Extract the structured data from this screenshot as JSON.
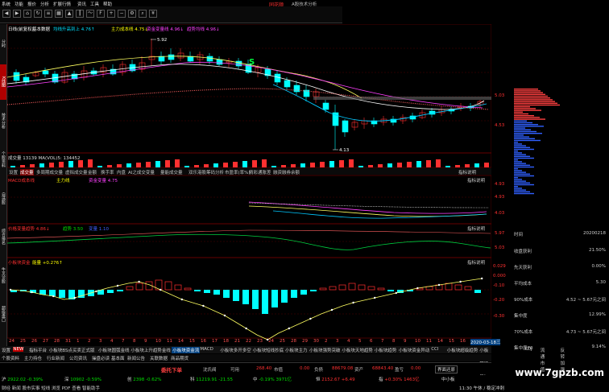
{
  "menubar": {
    "items": [
      "系统",
      "功能",
      "报价",
      "分析",
      "扩展行情",
      "资讯",
      "工具",
      "帮助"
    ],
    "logo": "同花顺",
    "title": "A股技术分析"
  },
  "sidebar": {
    "tabs": [
      "分时",
      "K线图",
      "技术分析",
      "个股资料",
      "自选股",
      "综合排名",
      "牛叉诊股",
      "超级盘口"
    ],
    "active": 1
  },
  "main_chart": {
    "header_items": [
      {
        "text": "日线(前复权)",
        "color": "#ffffff"
      },
      {
        "text": "基本数据",
        "color": "#ffffff"
      },
      {
        "text": "均线升高到上 4.76↑",
        "color": "#00e0ff"
      },
      {
        "text": "主力成本线 4.75↓",
        "color": "#ffff00"
      },
      {
        "text": "资金变量线 4.96↓",
        "color": "#ff40ff"
      },
      {
        "text": "趋势均线 4.96↓",
        "color": "#ff40ff"
      }
    ],
    "high_label": "5.92",
    "low_label": "4.13",
    "s_marker": "S",
    "price_ticks": [
      "5.03",
      "4.53"
    ]
  },
  "volume_panel": {
    "header": "成交量 13139 MA(VOL)5: 134452"
  },
  "indicator_tabs": [
    "设置",
    "成交量",
    "多周期成交量",
    "虚拟成交量",
    "金额",
    "换手率",
    "内盘",
    "AI之成交变量",
    "量能成交量",
    "双乐港股筹码分析",
    "市盈率(率%)",
    "精彩通胀差",
    "融资融券余额"
  ],
  "panel2": {
    "header_items": [
      {
        "text": "MACD成本线",
        "color": "#ff3030"
      },
      {
        "text": "主力线",
        "color": "#ffff00"
      },
      {
        "text": "资金变量 4.75",
        "color": "#ff40ff"
      }
    ],
    "right_label": "指标说明",
    "ticks": [
      "4.93",
      "4.93",
      "4.03"
    ]
  },
  "panel3": {
    "header_items": [
      {
        "text": "价格变量趋势 4.86↓",
        "color": "#ff3030"
      },
      {
        "text": "趋势 3.50",
        "color": "#00e000"
      },
      {
        "text": "变量 1.10",
        "color": "#4060ff"
      }
    ],
    "right_label": "指标说明",
    "ticks": [
      "5.97",
      "5.03"
    ]
  },
  "panel4": {
    "header_items": [
      {
        "text": "小板块资金",
        "color": "#ff3030"
      },
      {
        "text": "能量 +0.276↑",
        "color": "#ffff00"
      }
    ],
    "right_label": "指标说明",
    "ticks": [
      "0.029",
      "0.000",
      "-0.10",
      "-0.20",
      "-0.30"
    ]
  },
  "timeline": {
    "labels": [
      "24",
      "25",
      "26",
      "27",
      "28",
      "31",
      "1",
      "2",
      "3",
      "4",
      "7",
      "8",
      "9",
      "10",
      "11",
      "14",
      "15",
      "16",
      "17",
      "18",
      "21",
      "22",
      "23",
      "24",
      "25",
      "28",
      "29",
      "30",
      "2",
      "3",
      "4",
      "5",
      "6",
      "7",
      "8",
      "9",
      "10",
      "11",
      "14",
      "15",
      "16",
      "17"
    ],
    "date_box": "2020-03-18三"
  },
  "bottom_tabs": [
    {
      "label": "设置",
      "active": false
    },
    {
      "label": "NEW",
      "active": false
    },
    {
      "label": "指标平台",
      "active": false
    },
    {
      "label": "小板块BS点买卖正式版",
      "active": false
    },
    {
      "label": "小板块圆弧金线",
      "active": false
    },
    {
      "label": "小板块上升趋势金线",
      "active": false
    },
    {
      "label": "小板块资金流",
      "active": true
    },
    {
      "label": "MACD",
      "active": false
    },
    {
      "label": "小板块多开多空",
      "active": false
    },
    {
      "label": "小板块短线抄底",
      "active": false
    },
    {
      "label": "小板块主力",
      "active": false
    },
    {
      "label": "小板块强势突破",
      "active": false
    },
    {
      "label": "小板块天地趋势",
      "active": false
    },
    {
      "label": "小板块趋势",
      "active": false
    },
    {
      "label": "小板块资金异动",
      "active": false
    },
    {
      "label": "CCI",
      "active": false
    },
    {
      "label": "小板块超级趋势",
      "active": false
    },
    {
      "label": "小板块操盘线（2号）",
      "active": false
    },
    {
      "label": "KDJ",
      "active": false
    },
    {
      "label": "流通市值",
      "active": false
    },
    {
      "label": "反转加强",
      "active": false
    }
  ],
  "sub_tabs": [
    "个股资料",
    "主力持仓",
    "行业新闻",
    "公司资讯",
    "操盘必读",
    "基本面",
    "新闻公告",
    "关联数据",
    "商品期货"
  ],
  "tradebar": {
    "buy_button": "委托下单",
    "fields": [
      {
        "label": "沈氏阀",
        "value": ""
      },
      {
        "label": "可用",
        "value": "268.40"
      },
      {
        "label": "市值",
        "value": "0.00"
      },
      {
        "label": "负债",
        "value": "88679.08"
      },
      {
        "label": "资产",
        "value": "68843.40"
      },
      {
        "label": "盈亏",
        "value": "0.00"
      }
    ],
    "restore_button": "界面还原"
  },
  "status_row": [
    {
      "name": "沪",
      "value": "2922.02",
      "chg": "-0.39%",
      "color": "down"
    },
    {
      "name": "深",
      "value": "10902",
      "chg": "-0.59%",
      "color": "down"
    },
    {
      "name": "创",
      "value": "2398",
      "chg": "-0.62%",
      "color": "down"
    },
    {
      "name": "科",
      "value": "11219.91",
      "chg": "-21.55",
      "color": "down"
    },
    {
      "name": "中",
      "value": "-0.19%",
      "chg": "3971亿",
      "color": "down"
    },
    {
      "name": "恒",
      "value": "2152.67",
      "chg": "+6.49",
      "color": "up"
    },
    {
      "name": "指",
      "value": "+0.30%",
      "chg": "1463亿",
      "color": "up"
    },
    {
      "name": "中小板",
      "value": "",
      "chg": "",
      "color": "up"
    }
  ],
  "status_bottom": {
    "left": "财经 新闻 股市实事 短线 浏览 PDF 查看 智能助手",
    "right": "11:30 午休 / 稳定冲刺"
  },
  "right_panel": {
    "rows": [
      {
        "label": "时间",
        "value": "20200218"
      },
      {
        "label": "收盘获利",
        "value": "21.50%"
      },
      {
        "label": "获利盘",
        "value": ""
      },
      {
        "label": "先天获利",
        "value": "0.00%"
      },
      {
        "label": "平均成本",
        "value": "5.30"
      },
      {
        "label": "90%成本",
        "value": "4.52 ~ 5.67元之间"
      },
      {
        "label": "集中度",
        "value": "12.99%"
      },
      {
        "label": "70%成本",
        "value": "4.73 ~ 5.67元之间"
      },
      {
        "label": "集中度70",
        "value": "9.14%"
      }
    ]
  },
  "watermark": "www.7gpzb.com"
}
